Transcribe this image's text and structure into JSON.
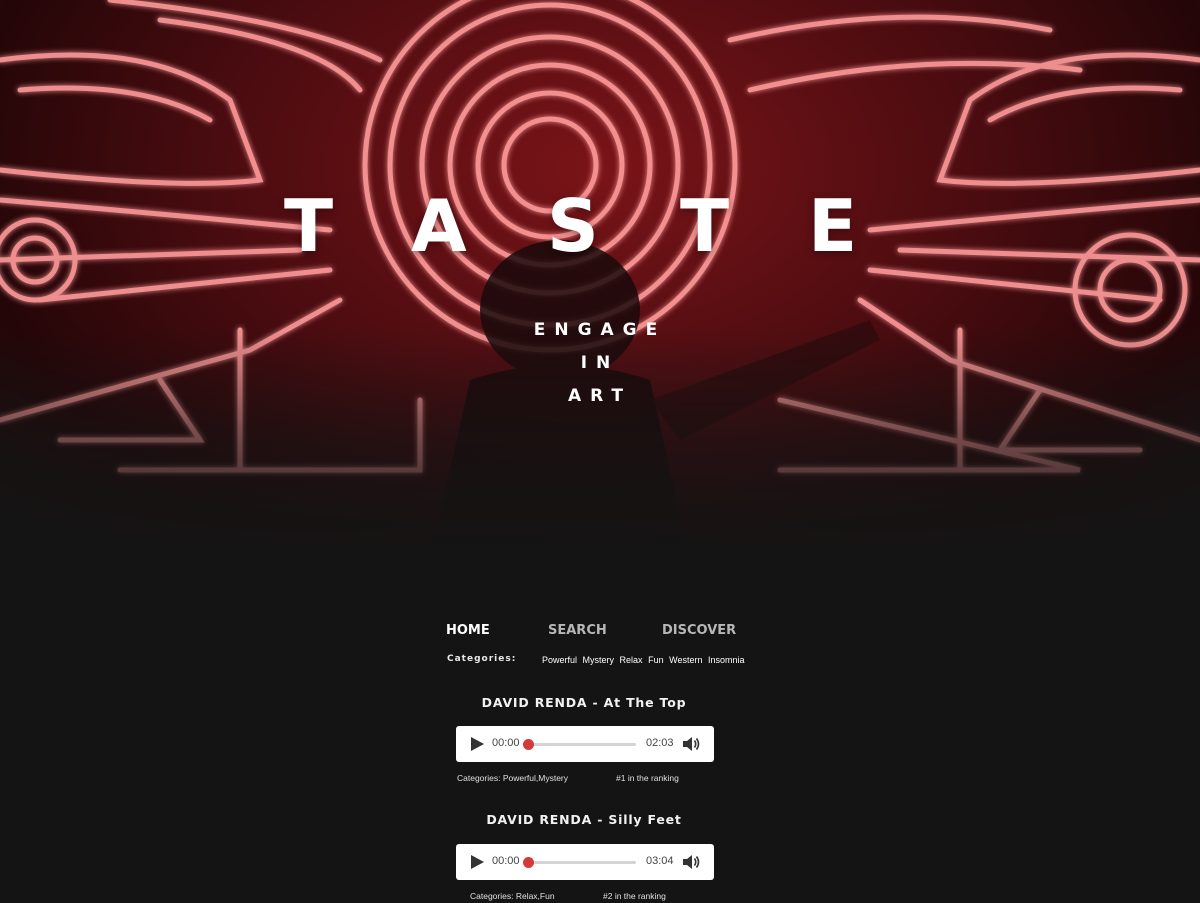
{
  "hero": {
    "title_letters": [
      "T",
      "A",
      "S",
      "T",
      "E"
    ],
    "tagline": [
      "ENGAGE",
      "IN",
      "ART"
    ]
  },
  "nav": {
    "items": [
      {
        "label": "HOME",
        "active": true
      },
      {
        "label": "SEARCH",
        "active": false
      },
      {
        "label": "DISCOVER",
        "active": false
      }
    ]
  },
  "categories": {
    "label": "Categories:",
    "items": [
      "Powerful",
      "Mystery",
      "Relax",
      "Fun",
      "Western",
      "Insomnia"
    ]
  },
  "tracks": [
    {
      "title": "DAVID RENDA - At The Top",
      "current_time": "00:00",
      "duration": "02:03",
      "progress": 0,
      "categories_text": "Categories: Powerful,Mystery",
      "ranking_text": "#1 in the ranking"
    },
    {
      "title": "DAVID RENDA - Silly Feet",
      "current_time": "00:00",
      "duration": "03:04",
      "progress": 0,
      "categories_text": "Categories: Relax,Fun",
      "ranking_text": "#2 in the ranking"
    }
  ],
  "colors": {
    "background": "#141414",
    "accent": "#d33a3a",
    "neon": "#ff5a5a"
  },
  "icons": {
    "play": "play-icon",
    "volume": "volume-icon"
  }
}
